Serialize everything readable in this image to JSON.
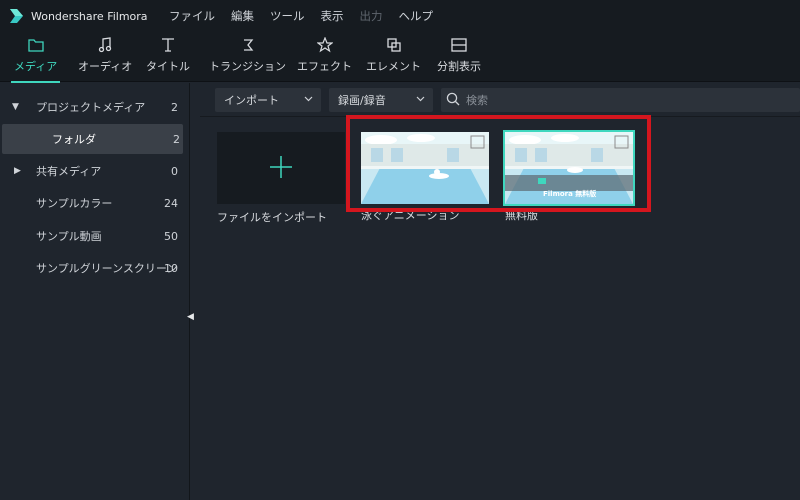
{
  "app": {
    "title": "Wondershare Filmora"
  },
  "menu": [
    {
      "label": "ファイル",
      "enabled": true
    },
    {
      "label": "編集",
      "enabled": true
    },
    {
      "label": "ツール",
      "enabled": true
    },
    {
      "label": "表示",
      "enabled": true
    },
    {
      "label": "出力",
      "enabled": false
    },
    {
      "label": "ヘルプ",
      "enabled": true
    }
  ],
  "toolbar": {
    "items": [
      {
        "label": "メディア",
        "icon": "folder-icon",
        "active": true
      },
      {
        "label": "オーディオ",
        "icon": "music-note-icon"
      },
      {
        "label": "タイトル",
        "icon": "text-icon"
      },
      {
        "label": "トランジション",
        "icon": "transition-icon"
      },
      {
        "label": "エフェクト",
        "icon": "effects-icon"
      },
      {
        "label": "エレメント",
        "icon": "element-icon"
      },
      {
        "label": "分割表示",
        "icon": "split-screen-icon"
      }
    ]
  },
  "sidebar": {
    "items": [
      {
        "label": "プロジェクトメディア",
        "count": "2",
        "expanded": true
      },
      {
        "label": "フォルダ",
        "count": "2",
        "selected": true
      },
      {
        "label": "共有メディア",
        "count": "0",
        "expanded": false
      },
      {
        "label": "サンプルカラー",
        "count": "24"
      },
      {
        "label": "サンプル動画",
        "count": "50"
      },
      {
        "label": "サンプルグリーンスクリーン",
        "count": "10"
      }
    ]
  },
  "filterbar": {
    "import_label": "インポート",
    "record_label": "録画/録音",
    "search_placeholder": "検索"
  },
  "media": {
    "import_tile_label": "ファイルをインポート",
    "items": [
      {
        "label": "泳ぐアニメーション",
        "selected": false
      },
      {
        "label": "無料版",
        "selected": true,
        "watermark": "Filmora 無料版"
      }
    ]
  },
  "colors": {
    "accent": "#3fd7be",
    "highlight": "#d4161e",
    "background": "#1f252d",
    "titlebar": "#161b20"
  }
}
